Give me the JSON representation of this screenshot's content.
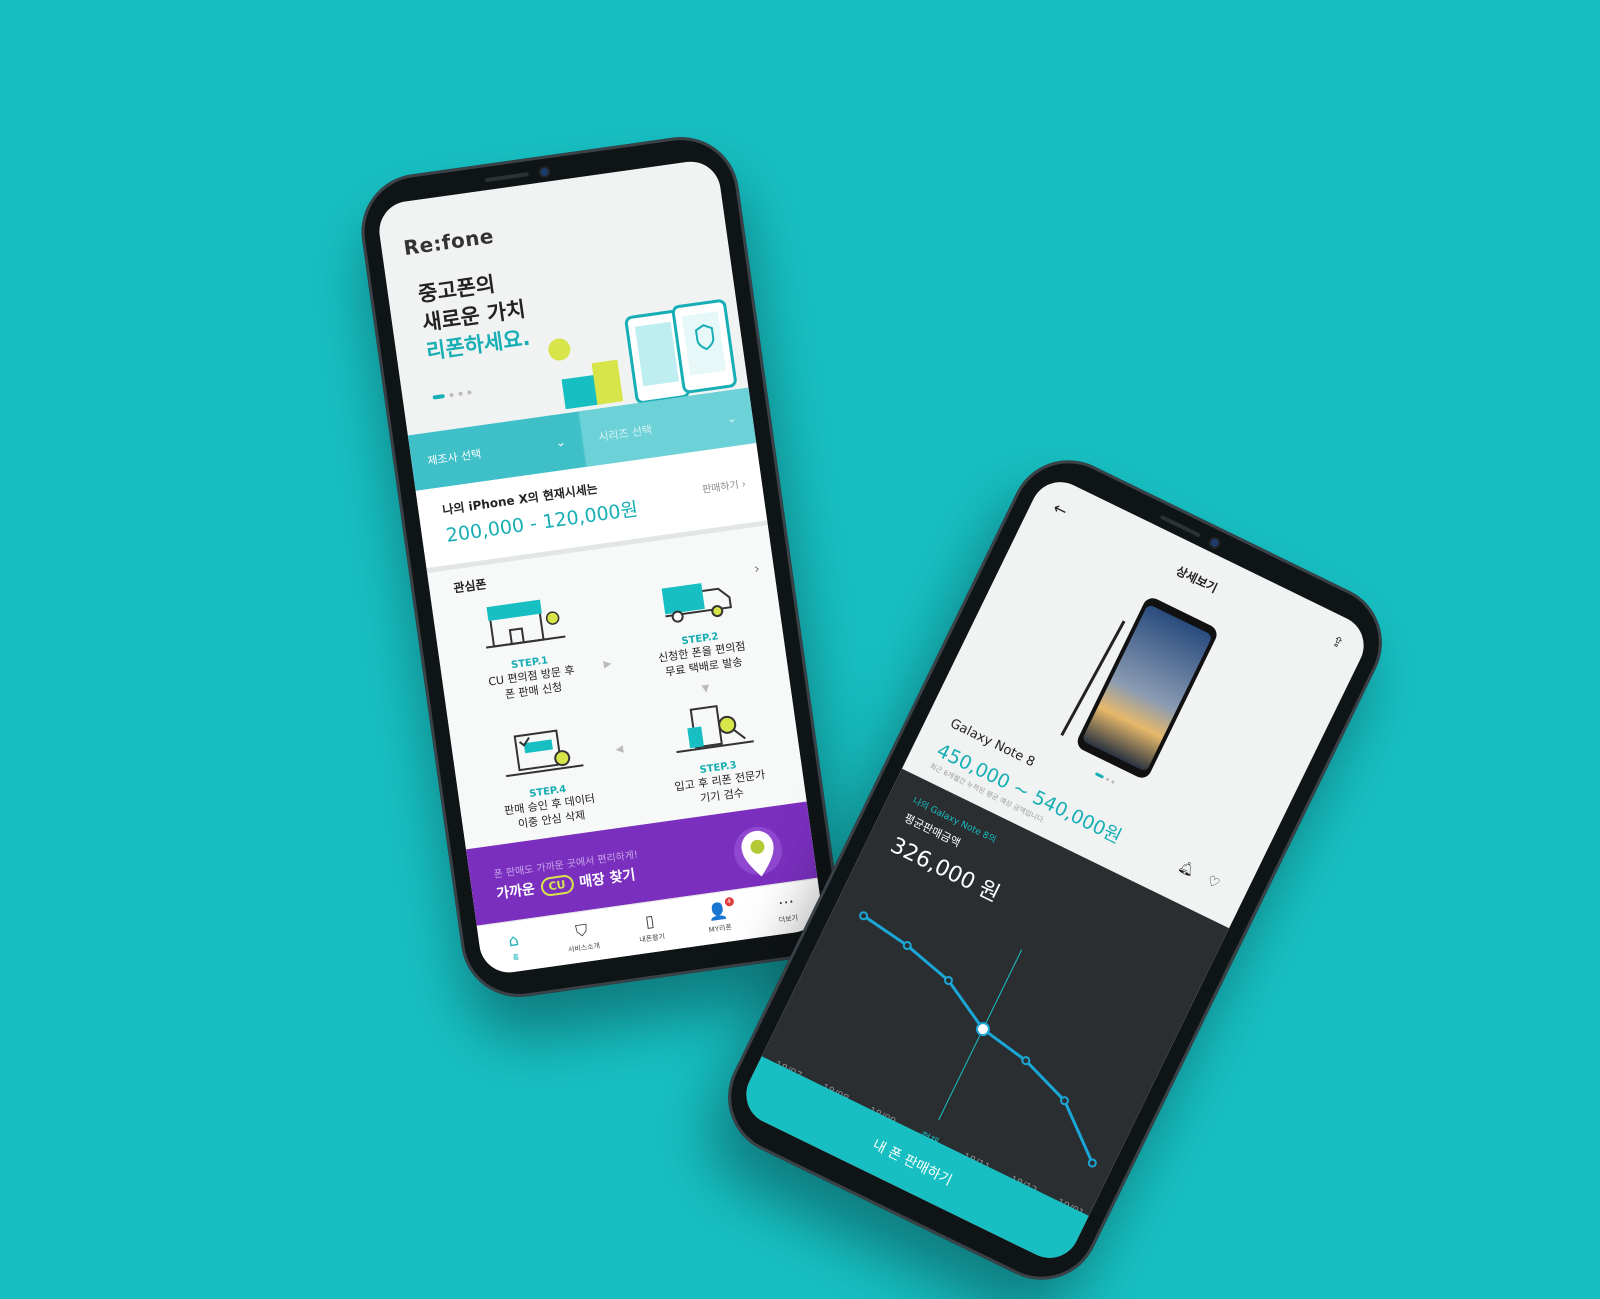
{
  "colors": {
    "background": "#17bfc2",
    "accent": "#17aeb4",
    "banner": "#7b2fbf",
    "cu": "#d7e54a",
    "dark": "#2b2e30"
  },
  "home": {
    "logo": "Re:fone",
    "hero": {
      "line1": "중고폰의",
      "line2": "새로운 가치",
      "line3": "리폰하세요."
    },
    "selectors": {
      "maker": "제조사 선택",
      "series": "시리즈 선택"
    },
    "price": {
      "label": "나의 iPhone X의 현재시세는",
      "range": "200,000 - 120,000원",
      "sell": "판매하기"
    },
    "interest": {
      "title": "관심폰",
      "steps": [
        {
          "label": "STEP.1",
          "line1": "CU 편의점 방문 후",
          "line2": "폰 판매 신청"
        },
        {
          "label": "STEP.2",
          "line1": "신청한 폰을 편의점",
          "line2": "무료 택배로 발송"
        },
        {
          "label": "STEP.3",
          "line1": "입고 후 리폰 전문가",
          "line2": "기기 검수"
        },
        {
          "label": "STEP.4",
          "line1": "판매 승인 후 데이터",
          "line2": "이중 안심 삭제"
        }
      ]
    },
    "banner": {
      "top": "폰 판매도 가까운 곳에서 편리하게!",
      "prefix": "가까운",
      "cu": "CU",
      "suffix": "매장 찾기"
    },
    "nav": [
      {
        "icon": "home-icon",
        "label": "홈"
      },
      {
        "icon": "bookmark-icon",
        "label": "서비스소개"
      },
      {
        "icon": "phone-icon",
        "label": "내폰팔기"
      },
      {
        "icon": "user-icon",
        "label": "MY리폰",
        "badge": "4"
      },
      {
        "icon": "more-icon",
        "label": "더보기"
      }
    ]
  },
  "detail": {
    "title": "상세보기",
    "model": "Galaxy Note 8",
    "price_range": "450,000 ~ 540,000원",
    "note": "최근 6개월간 누적된 평균 예상 금액입니다.",
    "dark": {
      "sub": "나의 Galaxy Note 8의",
      "label": "평균판매금액",
      "value": "326,000 원"
    },
    "chart_data": {
      "type": "line",
      "categories": [
        "18/07",
        "18/08",
        "18/09",
        "현재",
        "18/11",
        "18/12",
        "19/01"
      ],
      "highlight": "현재",
      "values": [
        352,
        348,
        341,
        326,
        321,
        311,
        288
      ]
    },
    "sell_button": "내 폰 판매하기"
  }
}
